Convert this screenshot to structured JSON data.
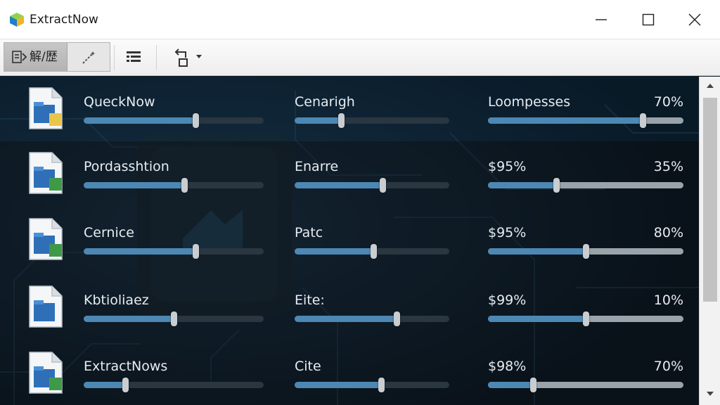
{
  "window": {
    "title": "ExtractNow"
  },
  "toolbar": {
    "extract_label": "解/歴"
  },
  "rows": [
    {
      "name": "QueckNow",
      "col2": "Cenarigh",
      "col3": "Loompesses",
      "percent": "70%",
      "bar1": 0.62,
      "bar2": 0.3,
      "bar3": 0.79
    },
    {
      "name": "Pordasshtion",
      "col2": "Enarre",
      "col3": "$95%",
      "percent": "35%",
      "bar1": 0.56,
      "bar2": 0.57,
      "bar3": 0.35
    },
    {
      "name": "Cernice",
      "col2": "Patc",
      "col3": "$95%",
      "percent": "80%",
      "bar1": 0.62,
      "bar2": 0.51,
      "bar3": 0.5
    },
    {
      "name": "Kbtioliaez",
      "col2": "Eite:",
      "col3": "$99%",
      "percent": "10%",
      "bar1": 0.5,
      "bar2": 0.66,
      "bar3": 0.5
    },
    {
      "name": "ExtractNows",
      "col2": "Cite",
      "col3": "$98%",
      "percent": "70%",
      "bar1": 0.23,
      "bar2": 0.56,
      "bar3": 0.23
    }
  ]
}
